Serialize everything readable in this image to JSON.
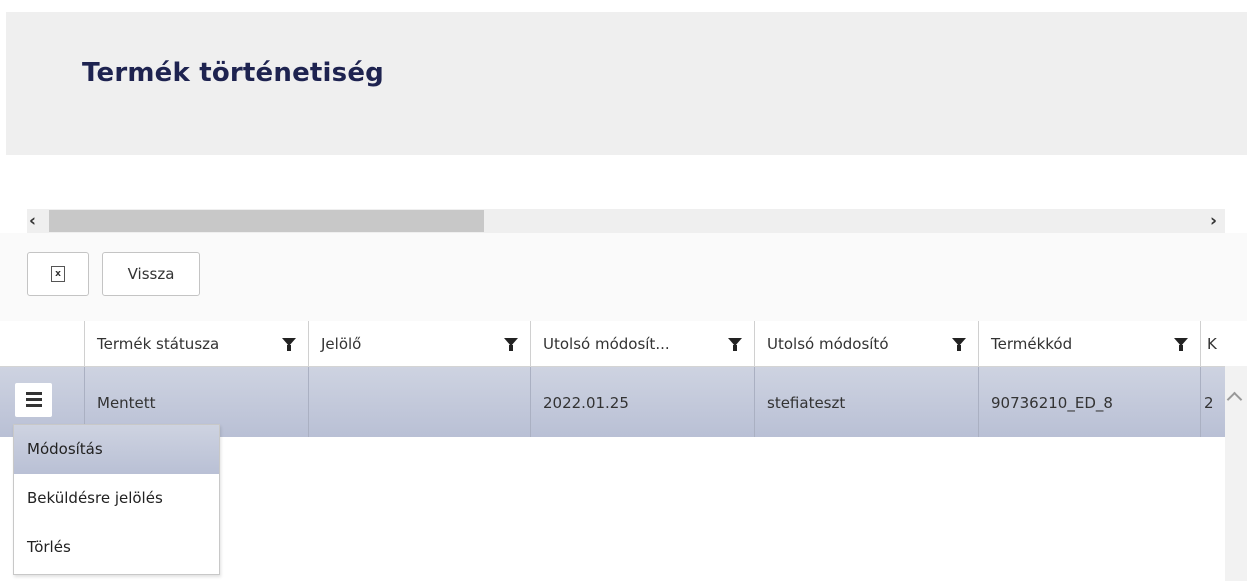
{
  "page": {
    "title": "Termék történetiség"
  },
  "toolbar": {
    "excel_icon": "excel-export-icon",
    "back_label": "Vissza"
  },
  "grid": {
    "columns": [
      {
        "label": "Termék státusza"
      },
      {
        "label": "Jelölő"
      },
      {
        "label": "Utolsó módosít..."
      },
      {
        "label": "Utolsó módosító"
      },
      {
        "label": "Termékkód"
      },
      {
        "label": "K"
      }
    ],
    "rows": [
      {
        "cells": [
          "Mentett",
          "",
          "2022.01.25",
          "stefiateszt",
          "90736210_ED_8",
          "2"
        ]
      }
    ]
  },
  "row_menu": {
    "items": [
      {
        "label": "Módosítás",
        "active": true
      },
      {
        "label": "Beküldésre jelölés",
        "active": false
      },
      {
        "label": "Törlés",
        "active": false
      }
    ]
  },
  "colors": {
    "title": "#1e2350",
    "selected_row": "#c4cadb",
    "header_bg": "#efefef"
  }
}
